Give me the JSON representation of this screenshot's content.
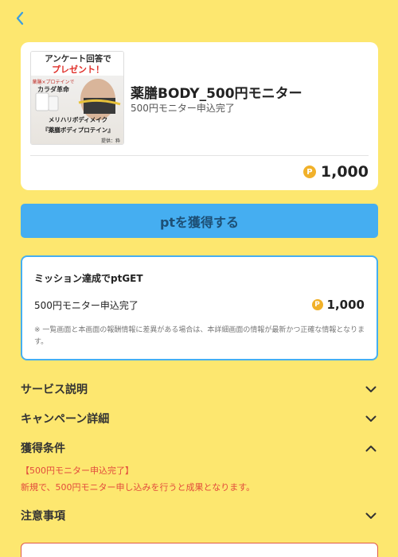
{
  "offer": {
    "title": "薬膳BODY_500円モニター",
    "subtitle": "500円モニター申込完了",
    "points": "1,000",
    "coin_symbol": "P",
    "thumbnail": {
      "line1": "アンケート回答で",
      "line2": "プレゼント！",
      "line3": "薬膳×プロテインで",
      "line4": "カラダ革命",
      "line5": "メリハリボディメイク",
      "line6": "『薬膳ボディプロテイン』",
      "line7": "提供：粋"
    }
  },
  "get_button": {
    "label": "ptを獲得する"
  },
  "mission": {
    "title": "ミッション達成でptGET",
    "item_label": "500円モニター申込完了",
    "item_points": "1,000",
    "note": "※ 一覧画面と本画面の報酬情報に差異がある場合は、本詳細画面の情報が最新かつ正確な情報となります。"
  },
  "sections": {
    "service": "サービス説明",
    "campaign": "キャンペーン詳細",
    "conditions": "獲得条件",
    "notes": "注意事項"
  },
  "conditions": {
    "heading": "【500円モニター申込完了】",
    "text": "新規で、500円モニター申し込みを行うと成果となります。"
  },
  "colors": {
    "background": "#fde76f",
    "accent": "#45aef1",
    "coin": "#f1b12a",
    "alert": "#e24b3c"
  },
  "icons": {
    "back": "chevron-left-icon",
    "expand": "chevron-down-icon",
    "collapse": "chevron-up-icon",
    "points": "coin-icon"
  }
}
